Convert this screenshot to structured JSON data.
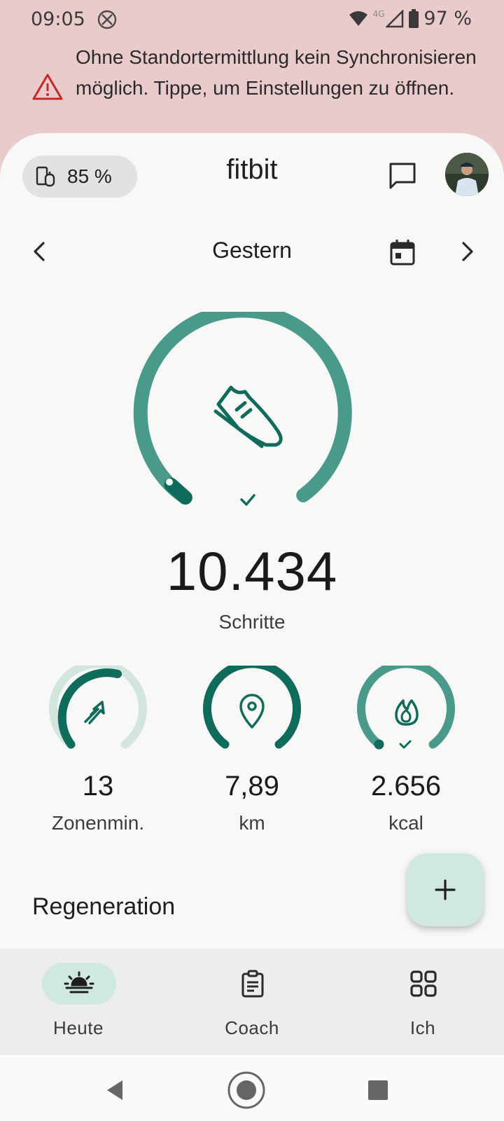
{
  "status_bar": {
    "time": "09:05",
    "network": "4G",
    "battery": "97 %"
  },
  "alert": {
    "text": "Ohne Standortermittlung kein Synchronisieren möglich. Tippe, um Einstellungen zu öffnen.",
    "icon": "warning-triangle-icon",
    "color": "#c62828"
  },
  "header": {
    "device_battery": "85 %",
    "title": "fitbit"
  },
  "date_nav": {
    "label": "Gestern"
  },
  "steps": {
    "value": "10.434",
    "label": "Schritte",
    "goal_progress": 1.0
  },
  "metrics": [
    {
      "name": "zone-minutes",
      "value": "13",
      "label": "Zonenmin.",
      "icon": "zone-arrows-icon",
      "progress": 0.6
    },
    {
      "name": "distance",
      "value": "7,89",
      "label": "km",
      "icon": "location-pin-icon",
      "progress": 1.0
    },
    {
      "name": "calories",
      "value": "2.656",
      "label": "kcal",
      "icon": "flame-icon",
      "progress": 1.0
    }
  ],
  "sections": {
    "regeneration": "Regeneration"
  },
  "bottom_nav": {
    "items": [
      {
        "label": "Heute",
        "icon": "sunrise-icon",
        "active": true
      },
      {
        "label": "Coach",
        "icon": "clipboard-icon",
        "active": false
      },
      {
        "label": "Ich",
        "icon": "grid-icon",
        "active": false
      }
    ]
  },
  "colors": {
    "accent": "#4a9a8b",
    "accent_dark": "#0f6b5c",
    "accent_light": "#cfe8e0",
    "alert_bg": "#e9cbcc"
  }
}
